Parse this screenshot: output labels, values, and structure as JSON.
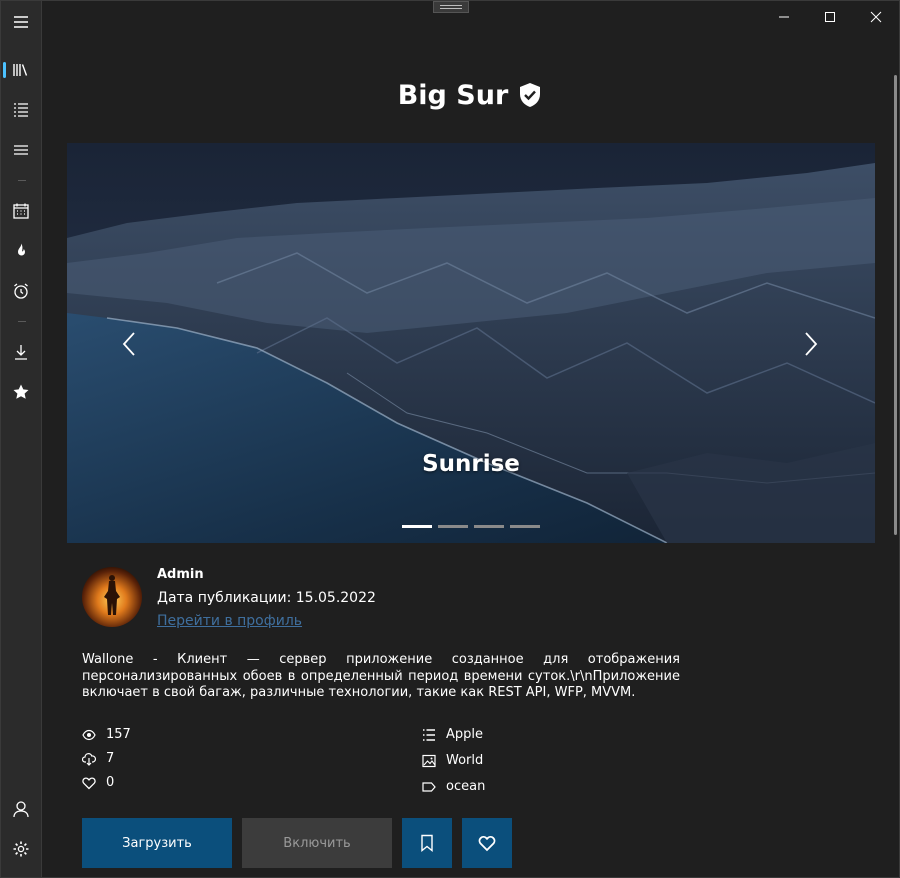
{
  "title": "Big Sur",
  "hero": {
    "caption": "Sunrise",
    "slide_count": 4,
    "active_slide": 1
  },
  "author": {
    "name": "Admin",
    "published": "Дата публикации: 15.05.2022",
    "profile_link": "Перейти в профиль"
  },
  "description": "Wallone - Клиент — сервер приложение созданное для отображения персонализированных обоев в определенный период времени суток.\\r\\nПриложение включает в свой багаж, различные технологии, такие как REST API, WFP, MVVM.",
  "stats": {
    "views": "157",
    "downloads": "7",
    "likes": "0"
  },
  "tags": {
    "brand": "Apple",
    "category": "World",
    "tag": "ocean"
  },
  "actions": {
    "download": "Загрузить",
    "enable": "Включить"
  },
  "nav_icons": [
    "menu-icon",
    "library-icon",
    "list-icon",
    "menu-lines-icon",
    "calendar-icon",
    "fire-icon",
    "alarm-icon",
    "download-icon",
    "star-icon",
    "user-icon",
    "settings-icon"
  ],
  "colors": {
    "accent": "#0b4f7c",
    "link": "#3f6f9e",
    "background": "#1f1f1f",
    "rail": "#2b2b2b"
  }
}
